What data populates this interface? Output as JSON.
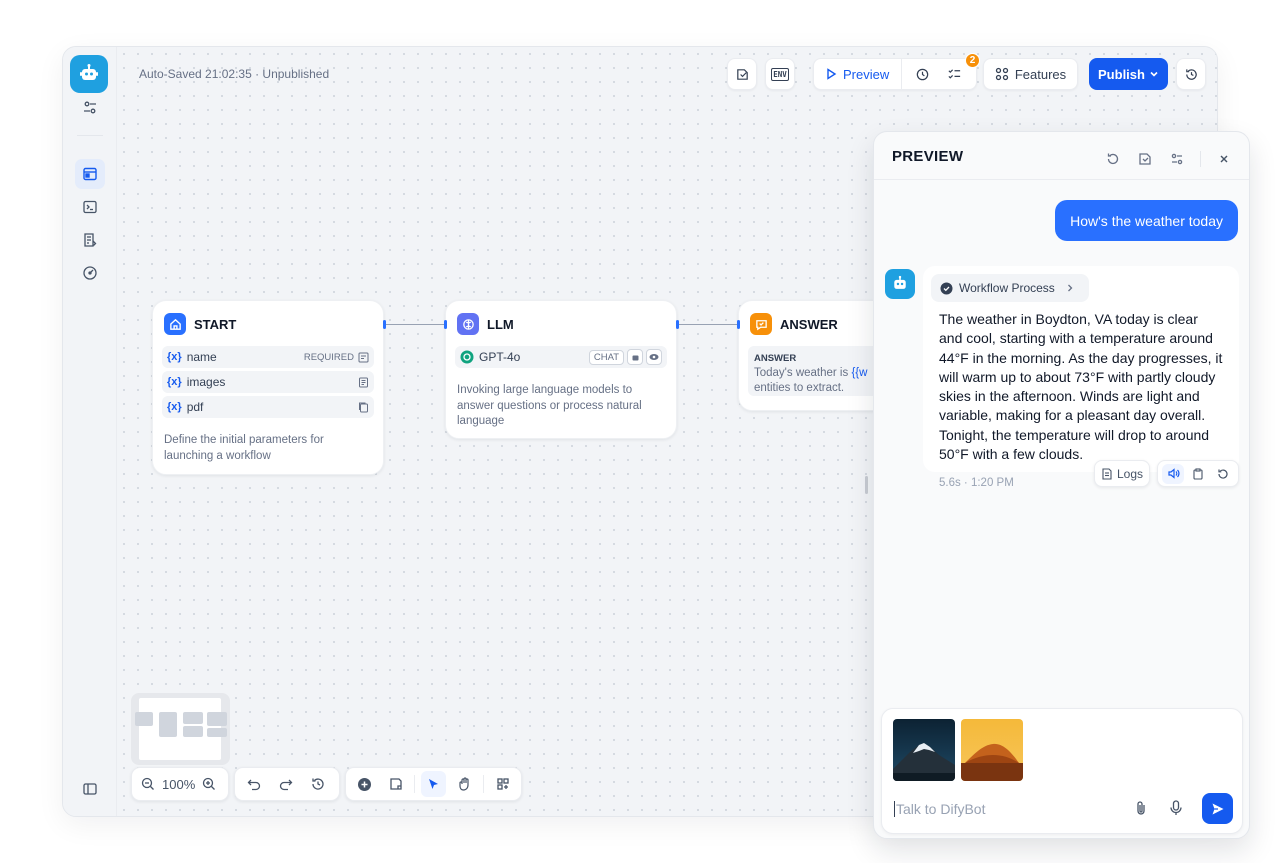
{
  "header": {
    "autosave": "Auto-Saved 21:02:35 · Unpublished",
    "preview_label": "Preview",
    "checklist_badge": "2",
    "features_label": "Features",
    "publish_label": "Publish",
    "env_label": "ENV"
  },
  "nodes": {
    "start": {
      "title": "START",
      "vars": [
        {
          "name": "name",
          "tag": "REQUIRED"
        },
        {
          "name": "images",
          "tag": ""
        },
        {
          "name": "pdf",
          "tag": ""
        }
      ],
      "var_prefix": "{x}",
      "desc": "Define the initial parameters for launching a workflow"
    },
    "llm": {
      "title": "LLM",
      "model": "GPT-4o",
      "mode": "CHAT",
      "desc": "Invoking large language models to answer questions or process natural language"
    },
    "answer": {
      "title": "ANSWER",
      "label": "ANSWER",
      "text_prefix": "Today's weather is ",
      "text_var": "{{w",
      "text_suffix": "entities to extract."
    }
  },
  "zoom": {
    "level": "100%"
  },
  "preview": {
    "title": "PREVIEW",
    "user_message": "How's the weather today",
    "workflow_process": "Workflow Process",
    "answer": "The weather in Boydton, VA today is clear and cool, starting with a temperature around 44°F in the morning. As the day progresses, it will warm up to about 73°F with partly cloudy skies in the afternoon. Winds are light and variable, making for a pleasant day overall. Tonight, the temperature will drop to around 50°F with a few clouds.",
    "meta": "5.6s · 1:20 PM",
    "logs_label": "Logs",
    "input_placeholder": "Talk to DifyBot"
  },
  "colors": {
    "primary": "#155aef",
    "start_icon": "#2970ff",
    "llm_icon": "#6172f3",
    "answer_icon": "#f79009",
    "badge": "#f79009"
  }
}
